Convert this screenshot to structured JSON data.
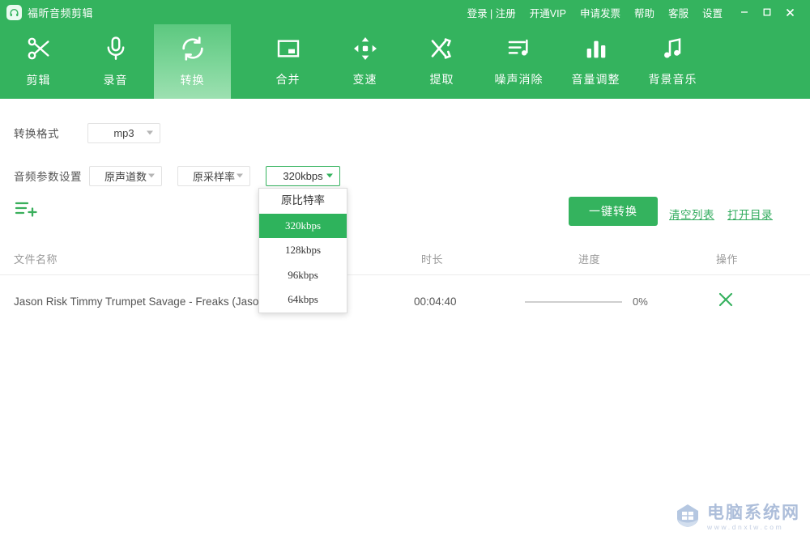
{
  "window": {
    "app_title": "福昕音频剪辑",
    "logo_icon": "headphones-icon",
    "menu": [
      {
        "name": "login-register",
        "label": "登录 | 注册"
      },
      {
        "name": "open-vip",
        "label": "开通VIP"
      },
      {
        "name": "request-invoice",
        "label": "申请发票"
      },
      {
        "name": "help",
        "label": "帮助"
      },
      {
        "name": "customer-service",
        "label": "客服"
      },
      {
        "name": "settings",
        "label": "设置"
      }
    ],
    "controls": {
      "minimize": "minimize-icon",
      "maximize": "maximize-icon",
      "close": "close-icon"
    }
  },
  "toolbar": {
    "active_index": 2,
    "items": [
      {
        "name": "edit",
        "label": "剪辑",
        "icon": "scissors-icon"
      },
      {
        "name": "record",
        "label": "录音",
        "icon": "microphone-icon"
      },
      {
        "name": "convert",
        "label": "转换",
        "icon": "refresh-icon"
      },
      {
        "name": "merge",
        "label": "合并",
        "icon": "merge-frame-icon"
      },
      {
        "name": "speed",
        "label": "变速",
        "icon": "speed-arrows-icon"
      },
      {
        "name": "extract",
        "label": "提取",
        "icon": "shuffle-icon"
      },
      {
        "name": "denoise",
        "label": "噪声消除",
        "icon": "playlist-note-icon"
      },
      {
        "name": "volume",
        "label": "音量调整",
        "icon": "bar-levels-icon"
      },
      {
        "name": "background-music",
        "label": "背景音乐",
        "icon": "music-note-icon"
      }
    ]
  },
  "settings": {
    "format_label": "转换格式",
    "format_value": "mp3",
    "audio_params_label": "音频参数设置",
    "channel_value": "原声道数",
    "samplerate_value": "原采样率",
    "bitrate_value": "320kbps"
  },
  "bitrate_dropdown": {
    "open": true,
    "selected": "320kbps",
    "options": [
      "原比特率",
      "320kbps",
      "128kbps",
      "96kbps",
      "64kbps"
    ]
  },
  "actions": {
    "add_file_icon": "add-file-icon",
    "convert_label": "一键转换",
    "clear_list_label": "清空列表",
    "open_dir_label": "打开目录"
  },
  "table": {
    "headers": {
      "name": "文件名称",
      "duration": "时长",
      "progress": "进度",
      "operation": "操作"
    },
    "rows": [
      {
        "name": "Jason Risk Timmy Trumpet Savage - Freaks (Jaso",
        "duration": "00:04:40",
        "progress_percent": "0%",
        "progress_value": 0,
        "delete_icon": "close-x-icon"
      }
    ]
  },
  "watermark": {
    "site_name": "电脑系统网",
    "url": "www.dnxtw.com",
    "icon": "house-shield-icon"
  },
  "colors": {
    "brand_green": "#34b35e",
    "active_tab_green": "#7ed69a",
    "dropdown_selected": "#2eb35c",
    "link_green": "#31ab5d",
    "watermark_blue": "#9fb3d4"
  }
}
